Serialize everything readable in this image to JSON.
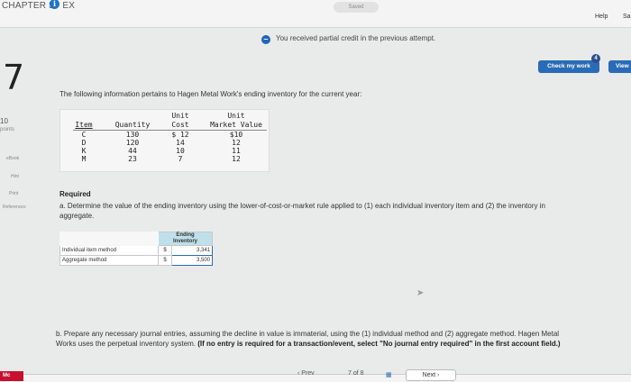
{
  "header": {
    "chapter": "CHAPTER 5 - EX",
    "info_glyph": "i",
    "saved": "Saved",
    "help": "Help",
    "save_exit": "Sa"
  },
  "notice": {
    "icon": "minus-circle-icon",
    "glyph": "–",
    "text": "You received partial credit in the previous attempt."
  },
  "actions": {
    "check_label": "Check my work",
    "badge": "4",
    "view_label": "View"
  },
  "question": {
    "number": "7",
    "score": "10",
    "points_label": "points",
    "intro": "The following information pertains to Hagen Metal Work's ending inventory for the current year:"
  },
  "sidebar": {
    "ebook": "eBook",
    "hint": "Hint",
    "print": "Print",
    "references": "References"
  },
  "inventory_table": {
    "headers": {
      "item": "Item",
      "quantity": "Quantity",
      "unit_cost_1": "Unit",
      "unit_cost_2": "Cost",
      "market_1": "Unit",
      "market_2": "Market Value"
    },
    "rows": [
      {
        "item": "C",
        "quantity": "130",
        "cost": "$ 12",
        "market": "$10"
      },
      {
        "item": "D",
        "quantity": "120",
        "cost": "14",
        "market": "12"
      },
      {
        "item": "K",
        "quantity": "44",
        "cost": "10",
        "market": "11"
      },
      {
        "item": "M",
        "quantity": "23",
        "cost": "7",
        "market": "12"
      }
    ]
  },
  "required": {
    "title": "Required",
    "part_a": "a. Determine the value of the ending inventory using the lower-of-cost-or-market rule applied to (1) each individual inventory item and (2) the inventory in aggregate."
  },
  "answer_table": {
    "header_1": "Ending",
    "header_2": "Inventory",
    "rows": [
      {
        "label": "Individual item method",
        "dollar": "$",
        "value": "3,341"
      },
      {
        "label": "Aggregate method",
        "dollar": "$",
        "value": "3,500"
      }
    ]
  },
  "part_b": {
    "text": "b. Prepare any necessary journal entries, assuming the decline in value is immaterial, using the (1) individual method and (2) aggregate method. Hagen Metal Works uses the perpetual inventory system.",
    "bold": "(If no entry is required for a transaction/event, select \"No journal entry required\" in the first account field.)"
  },
  "footer": {
    "logo": "Mc",
    "prev": "Prev",
    "page_current": "7",
    "page_of": "of",
    "page_total": "8",
    "next": "Next"
  }
}
